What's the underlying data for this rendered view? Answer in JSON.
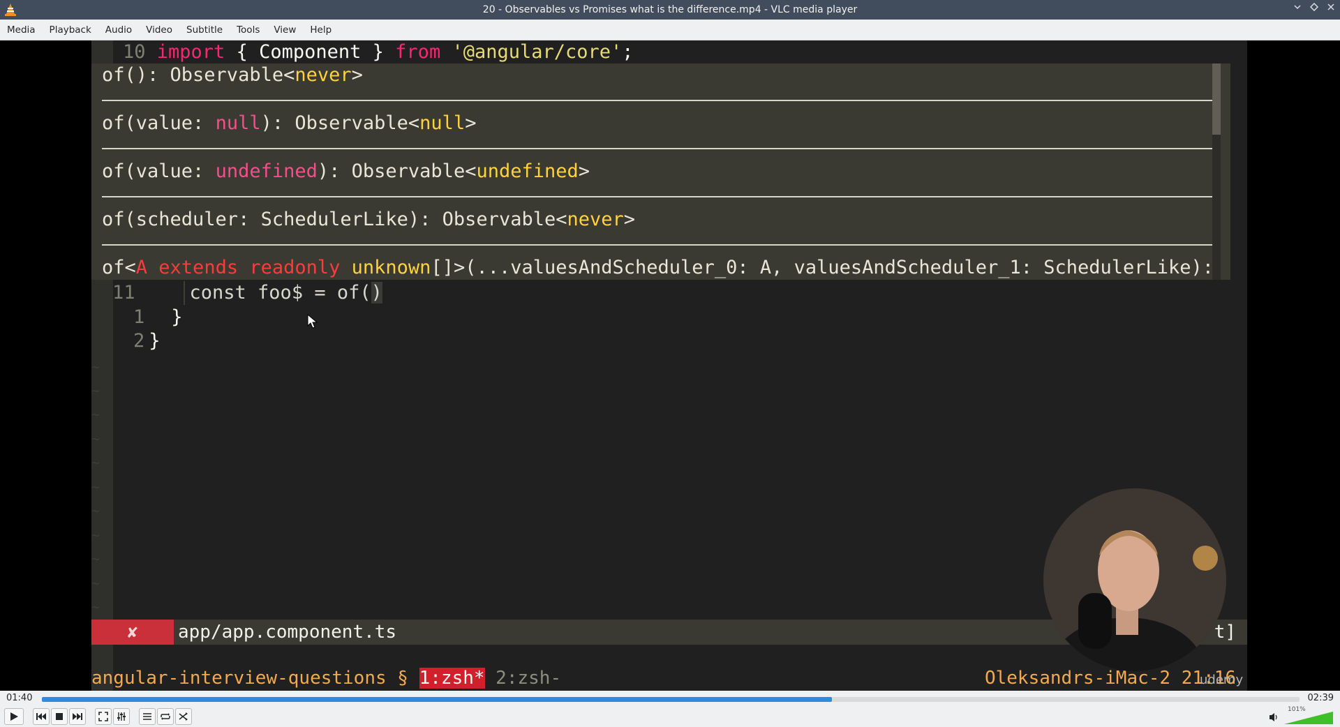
{
  "window": {
    "title": "20 - Observables vs Promises what is the difference.mp4 - VLC media player"
  },
  "menu": {
    "items": [
      "Media",
      "Playback",
      "Audio",
      "Video",
      "Subtitle",
      "Tools",
      "View",
      "Help"
    ]
  },
  "editor": {
    "line_top": {
      "num": "10",
      "kw": "import",
      "body": " { Component } ",
      "from": "from",
      "str": " '@angular/core'",
      "semi": ";"
    },
    "popup": {
      "sig1": {
        "a": "of(): Observable<",
        "t": "never",
        "b": ">"
      },
      "sig2": {
        "a": "of(value: ",
        "k": "null",
        "b": "): Observable<",
        "t": "null",
        "c": ">"
      },
      "sig3": {
        "a": "of(value: ",
        "k": "undefined",
        "b": "): Observable<",
        "t": "undefined",
        "c": ">"
      },
      "sig4": {
        "a": "of(scheduler: SchedulerLike): Observable<",
        "t": "never",
        "b": ">"
      },
      "sig5": {
        "a": "of<",
        "r1": "A extends readonly",
        "t": " unknown",
        "b": "[]>(...valuesAndScheduler_0: A, valuesAndScheduler_1: SchedulerLike):"
      }
    },
    "line11": {
      "num": "11",
      "code": "const foo$ = of(",
      "caret": ")"
    },
    "line_r1": {
      "num": "1",
      "code": "}"
    },
    "line_r2": {
      "num": "2",
      "code": "}"
    },
    "tilde": "~"
  },
  "statusline": {
    "error_mark": "✘",
    "file": "app/app.component.ts",
    "right": "t]"
  },
  "tmux": {
    "session": "angular-interview-questions § ",
    "win1": "1:zsh*",
    "win2": " 2:zsh-",
    "host": "Oleksandrs-iMac-2 21:16"
  },
  "watermark": "udemy",
  "player": {
    "elapsed": "01:40",
    "total": "02:39",
    "progress": 0.628,
    "volume_label": "101%",
    "volume": 1.01
  }
}
